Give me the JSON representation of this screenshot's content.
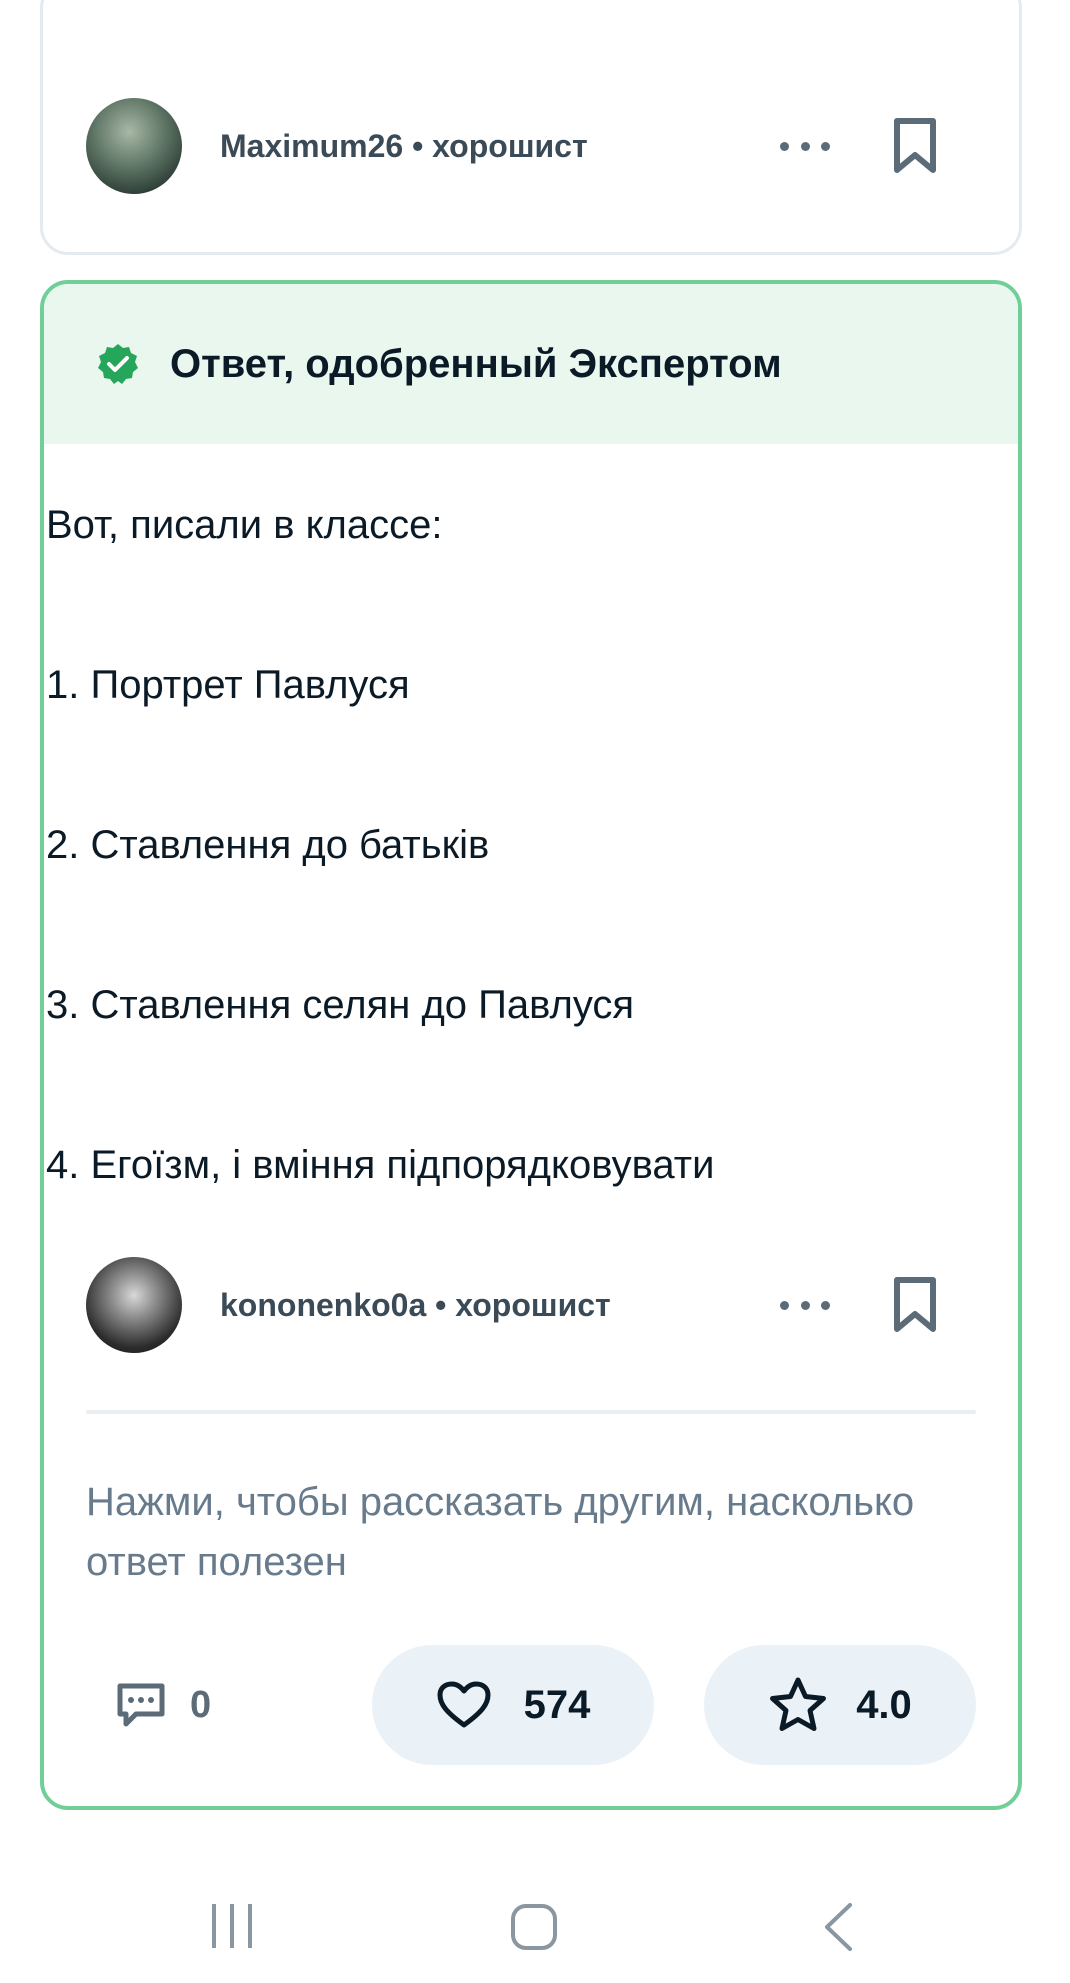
{
  "previous_answer": {
    "author_name": "Maximum26",
    "separator": " • ",
    "author_rank": "хорошист"
  },
  "expert_answer": {
    "header_title": "Ответ, одобренный Экспертом",
    "lines": [
      "Вот, писали в классе:",
      "1. Портрет Павлуся",
      "2. Ставлення до батьків",
      "3. Ставлення селян до Павлуся",
      "4. Егоїзм, і вміння підпорядковувати"
    ],
    "author_name": "kononenko0a",
    "separator": " • ",
    "author_rank": "хорошист",
    "rate_prompt": "Нажми, чтобы рассказать другим, насколько ответ полезен",
    "comment_count": "0",
    "like_count": "574",
    "rating": "4.0"
  },
  "colors": {
    "accent_green": "#6fcf97",
    "verified_green": "#26a65b",
    "header_bg": "#e9f7ef",
    "pill_bg": "#ebf2f7"
  },
  "icons": {
    "more": "more-icon",
    "bookmark": "bookmark-icon",
    "verified": "verified-badge-icon",
    "comment": "comment-icon",
    "like": "heart-icon",
    "rating": "star-icon",
    "nav_recents": "recents-icon",
    "nav_home": "home-icon",
    "nav_back": "back-icon"
  }
}
